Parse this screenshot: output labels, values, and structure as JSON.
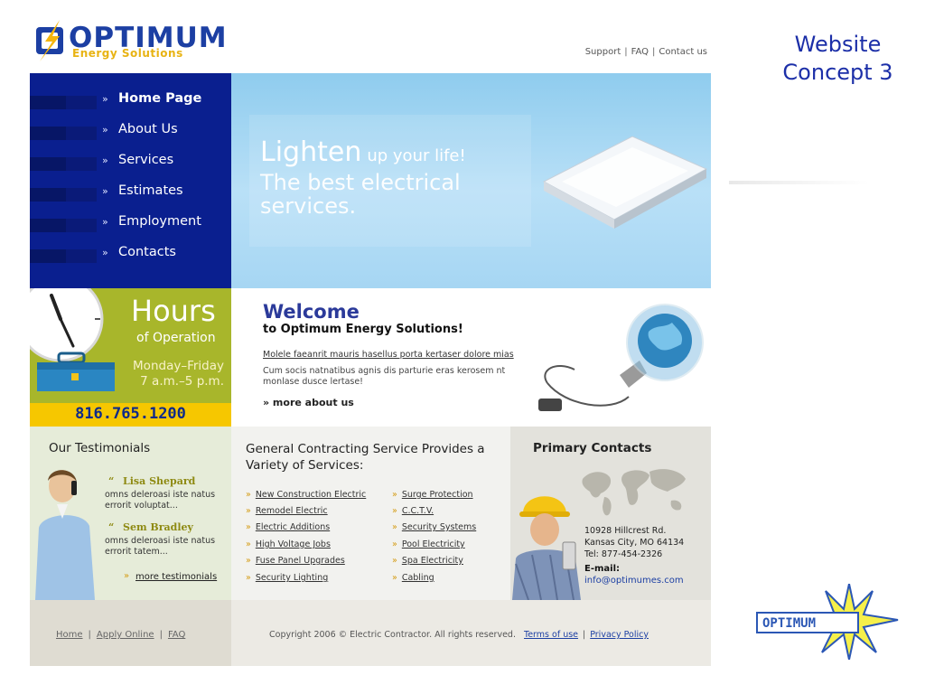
{
  "slide": {
    "title": "Website Concept 3"
  },
  "brand": {
    "name": "OPTIMUM",
    "tagline": "Energy Solutions",
    "mini_logo_text": "OPTIMUM"
  },
  "top_links": [
    "Support",
    "FAQ",
    "Contact us"
  ],
  "nav": {
    "items": [
      {
        "label": "Home Page",
        "active": true
      },
      {
        "label": "About Us"
      },
      {
        "label": "Services"
      },
      {
        "label": "Estimates"
      },
      {
        "label": "Employment"
      },
      {
        "label": "Contacts"
      }
    ],
    "arrow_glyph": "»"
  },
  "hero": {
    "headline_big": "Lighten",
    "headline_small": "up your life!",
    "subline": "The best electrical services."
  },
  "hours": {
    "title": "Hours",
    "subtitle": "of Operation",
    "days": "Monday–Friday",
    "time": "7 a.m.–5 p.m.",
    "phone": "816.765.1200"
  },
  "welcome": {
    "title": "Welcome",
    "subtitle": "to Optimum Energy Solutions!",
    "link_text": "Molele faeanrit mauris hasellus porta kertaser dolore mias",
    "body": "Cum socis natnatibus agnis dis parturie eras kerosem nt monlase dusce lertase!",
    "more": "» more about us"
  },
  "testimonials": {
    "heading": "Our Testimonials",
    "items": [
      {
        "name": "Lisa Shepard",
        "text": "omns deleroasi iste natus errorit voluptat..."
      },
      {
        "name": "Sem Bradley",
        "text": "omns deleroasi iste natus errorit tatem..."
      }
    ],
    "quote_glyph": "“",
    "more": "more testimonials"
  },
  "services": {
    "heading": "General Contracting Service Provides a Variety of Services:",
    "left": [
      "New Construction Electric",
      "Remodel Electric",
      "Electric Additions",
      "High Voltage Jobs",
      "Fuse Panel Upgrades",
      "Security Lighting"
    ],
    "right": [
      "Surge Protection",
      "C.C.T.V.",
      "Security Systems",
      "Pool Electricity",
      "Spa Electricity",
      "Cabling"
    ],
    "arrow_glyph": "»"
  },
  "contacts": {
    "heading": "Primary Contacts",
    "address": [
      "10928 Hillcrest Rd.",
      "Kansas City, MO 64134",
      "Tel: 877-454-2326"
    ],
    "email_label": "E-mail:",
    "email": "info@optimumes.com"
  },
  "footer": {
    "links": [
      "Home",
      "Apply Online",
      "FAQ"
    ],
    "copyright": "Copyright 2006 © Electric Contractor. All rights reserved.",
    "terms": "Terms of use",
    "privacy": "Privacy Policy"
  },
  "colors": {
    "nav_bg": "#0a1f8f",
    "hero_sky": "#a6d6f3",
    "hours_bg": "#a8b62b",
    "phone_bar": "#f6c700",
    "slide_title": "#1c2fa8"
  }
}
